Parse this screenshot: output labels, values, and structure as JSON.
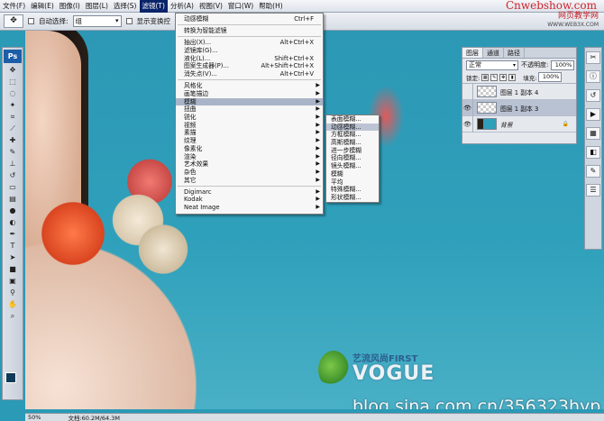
{
  "menubar": {
    "items": [
      "文件(F)",
      "编辑(E)",
      "图像(I)",
      "图层(L)",
      "选择(S)",
      "滤镜(T)",
      "分析(A)",
      "视图(V)",
      "窗口(W)",
      "帮助(H)"
    ],
    "brand": "Cnwebshow.com"
  },
  "watermark_top": {
    "line1": "网页教学网",
    "line2": "WWW.WEB3X.COM"
  },
  "options": {
    "auto_select_label": "自动选择:",
    "auto_select_value": "组",
    "show_transform_label": "显示变换控"
  },
  "toolbox": {
    "logo": "Ps"
  },
  "filter_menu": {
    "group1": [
      {
        "label": "动感模糊",
        "shortcut": "Ctrl+F"
      }
    ],
    "group2": [
      {
        "label": "转换为智能滤镜"
      }
    ],
    "group3": [
      {
        "label": "抽出(X)...",
        "shortcut": "Alt+Ctrl+X"
      },
      {
        "label": "滤镜库(G)..."
      },
      {
        "label": "液化(L)...",
        "shortcut": "Shift+Ctrl+X"
      },
      {
        "label": "图案生成器(P)...",
        "shortcut": "Alt+Shift+Ctrl+X"
      },
      {
        "label": "消失点(V)...",
        "shortcut": "Alt+Ctrl+V"
      }
    ],
    "group4": [
      {
        "label": "风格化"
      },
      {
        "label": "画笔描边"
      },
      {
        "label": "模糊"
      },
      {
        "label": "扭曲"
      },
      {
        "label": "锐化"
      },
      {
        "label": "视频"
      },
      {
        "label": "素描"
      },
      {
        "label": "纹理"
      },
      {
        "label": "像素化"
      },
      {
        "label": "渲染"
      },
      {
        "label": "艺术效果"
      },
      {
        "label": "杂色"
      },
      {
        "label": "其它"
      }
    ],
    "group5": [
      {
        "label": "Digimarc"
      },
      {
        "label": "Kodak"
      },
      {
        "label": "Neat Image"
      }
    ]
  },
  "blur_menu": {
    "items": [
      "表面模糊...",
      "动感模糊...",
      "方框模糊...",
      "高斯模糊...",
      "进一步模糊",
      "径向模糊...",
      "镜头模糊...",
      "模糊",
      "平均",
      "特殊模糊...",
      "形状模糊..."
    ]
  },
  "layers_panel": {
    "tabs": [
      "图层",
      "通道",
      "路径"
    ],
    "blend_mode": "正常",
    "opacity_label": "不透明度:",
    "opacity_value": "100%",
    "lock_label": "锁定:",
    "fill_label": "填充:",
    "fill_value": "100%",
    "layers": [
      {
        "name": "图层 1 副本 4"
      },
      {
        "name": "图层 1 副本 3"
      },
      {
        "name": "背景"
      }
    ]
  },
  "canvas": {
    "logo_line1": "艺流风尚FIRST",
    "logo_line2": "VOGUE",
    "blog_url": "blog.sina.com.cn/356323hyp"
  },
  "status": {
    "zoom": "50%",
    "doc": "文档:60.2M/64.3M"
  },
  "colors": {
    "accent": "#0a246a",
    "menu_highlight": "#a9b4c8",
    "foreground_swatch": "#0e3b57"
  }
}
